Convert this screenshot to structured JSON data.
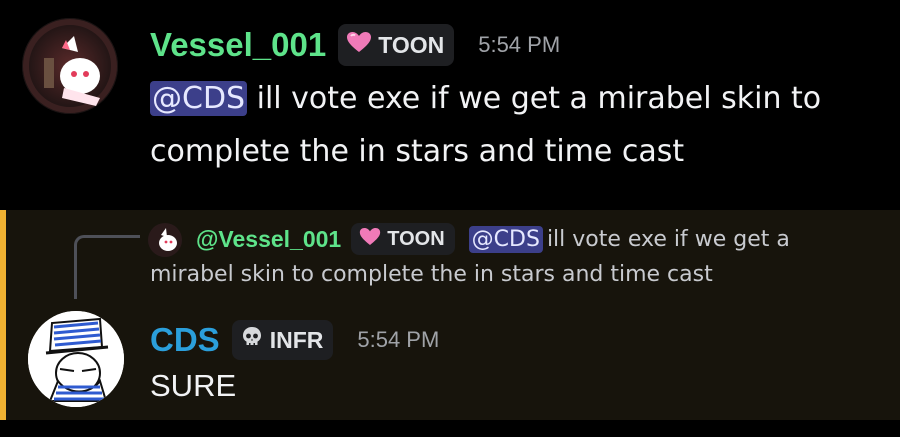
{
  "messages": {
    "first": {
      "username": "Vessel_001",
      "tag": "TOON",
      "tag_icon": "pink-heart-icon",
      "timestamp": "5:54 PM",
      "mention": "@CDS",
      "text_part1": " ill vote exe if we get a mirabel skin to",
      "text_part2": "complete the in stars and time cast"
    },
    "reply": {
      "reply_to": {
        "username": "@Vessel_001",
        "tag": "TOON",
        "mention": "@CDS",
        "text_line1": "ill vote exe if we get a",
        "text_line2": "mirabel skin to complete the in stars and time cast"
      },
      "username": "CDS",
      "tag": "INFR",
      "tag_icon": "skull-icon",
      "timestamp": "5:54 PM",
      "text": "SURE"
    }
  },
  "colors": {
    "vessel_name": "#5ee38a",
    "cds_name": "#2b9fdb",
    "mention_bg": "#3c3f8a",
    "highlight_bar": "#f0b232"
  }
}
